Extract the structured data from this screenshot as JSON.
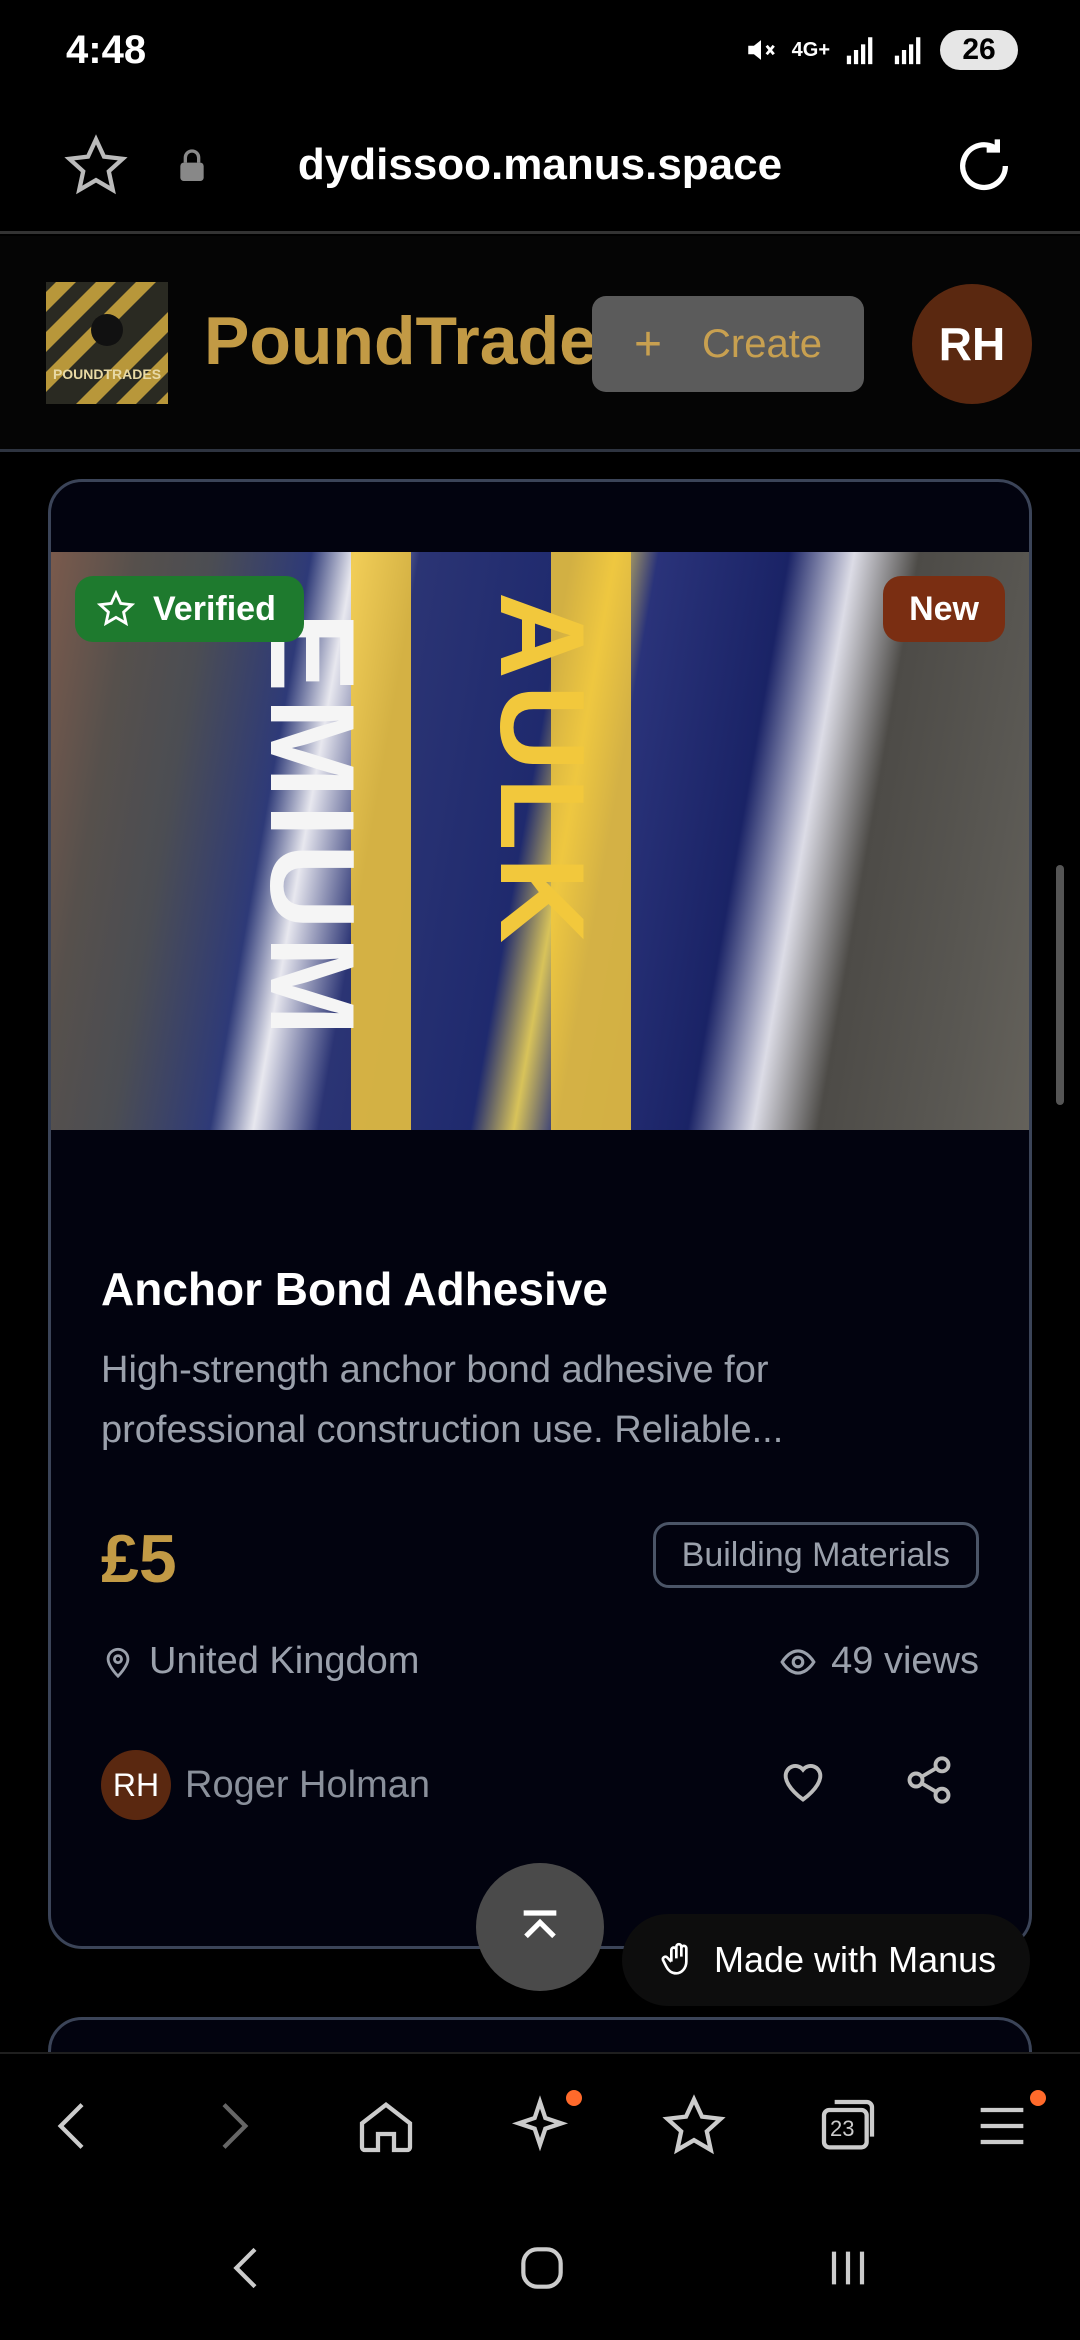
{
  "status_bar": {
    "time": "4:48",
    "network": "4G+",
    "battery": "26"
  },
  "url_bar": {
    "url": "dydissoo.manus.space"
  },
  "header": {
    "logo_text": "POUNDTRADES",
    "brand": "PoundTrade",
    "create_label": "Create",
    "avatar_initials": "RH"
  },
  "listing": {
    "badge_verified": "Verified",
    "badge_new": "New",
    "title": "Anchor Bond Adhesive",
    "description": "High-strength anchor bond adhesive for professional construction use. Reliable...",
    "price": "£5",
    "category": "Building Materials",
    "location": "United Kingdom",
    "views": "49 views",
    "seller_initials": "RH",
    "seller_name": "Roger Holman",
    "image_text_1": "EMIUM",
    "image_text_2": "AULK"
  },
  "made_with": "Made with Manus",
  "browser_bar": {
    "tabs_count": "23"
  },
  "colors": {
    "accent": "#c29a45",
    "verified": "#1e7a2e",
    "new": "#7a2e12",
    "avatar": "#5a2810"
  }
}
